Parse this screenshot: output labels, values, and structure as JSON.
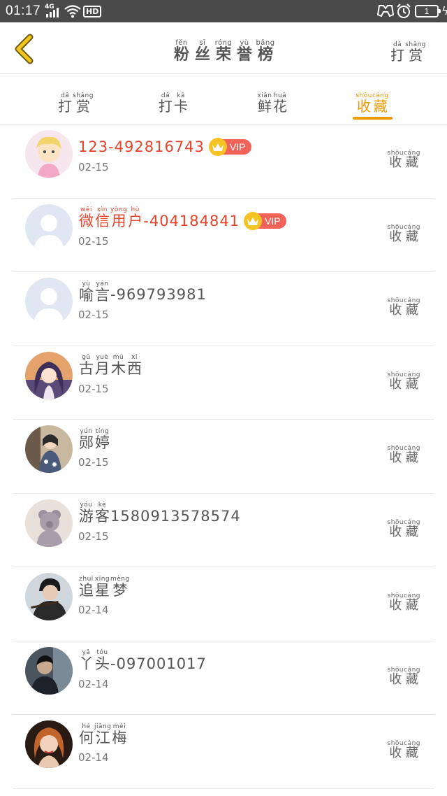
{
  "status_bar": {
    "time": "01:17",
    "network": "4G",
    "hd_label": "HD",
    "battery_level": "1",
    "icons": [
      "signal-icon",
      "wifi-icon",
      "hd-icon",
      "game-icon",
      "alarm-icon",
      "battery-icon",
      "charging-icon"
    ]
  },
  "header": {
    "back_icon": "chevron-left-icon",
    "title": [
      {
        "py": "fěn",
        "hz": "粉"
      },
      {
        "py": "sī",
        "hz": "丝"
      },
      {
        "py": "róng",
        "hz": "荣"
      },
      {
        "py": "yù",
        "hz": "誉"
      },
      {
        "py": "bǎng",
        "hz": "榜"
      }
    ],
    "action": [
      {
        "py": "dǎ",
        "hz": "打"
      },
      {
        "py": "shǎng",
        "hz": "赏"
      }
    ]
  },
  "tabs": [
    {
      "chars": [
        {
          "py": "dǎ",
          "hz": "打"
        },
        {
          "py": "shǎng",
          "hz": "赏"
        }
      ],
      "active": false
    },
    {
      "chars": [
        {
          "py": "dǎ",
          "hz": "打"
        },
        {
          "py": "kǎ",
          "hz": "卡"
        }
      ],
      "active": false
    },
    {
      "chars": [
        {
          "py": "xiān",
          "hz": "鲜"
        },
        {
          "py": "huā",
          "hz": "花"
        }
      ],
      "active": false
    },
    {
      "chars": [
        {
          "py": "shōu",
          "hz": "收"
        },
        {
          "py": "cáng",
          "hz": "藏"
        }
      ],
      "active": true
    }
  ],
  "colors": {
    "accent": "#f39800",
    "vip_name": "#e6432b",
    "vip_badge": "#f1635a",
    "crown": "#f6c325",
    "status_bar": "#4a4a4a"
  },
  "row_action": [
    {
      "py": "shōu",
      "hz": "收"
    },
    {
      "py": "cáng",
      "hz": "藏"
    }
  ],
  "users": [
    {
      "chars": [],
      "suffix": "123-492816743",
      "vip": true,
      "vip_label": "VIP",
      "date": "02-15",
      "avatar": "cartoon-girl-avatar"
    },
    {
      "chars": [
        {
          "py": "wēi",
          "hz": "微"
        },
        {
          "py": "xìn",
          "hz": "信"
        },
        {
          "py": "yòng",
          "hz": "用"
        },
        {
          "py": "hù",
          "hz": "户"
        }
      ],
      "suffix": "-404184841",
      "vip": true,
      "vip_label": "VIP",
      "date": "02-15",
      "avatar": "default-user-avatar"
    },
    {
      "chars": [
        {
          "py": "yù",
          "hz": "喻"
        },
        {
          "py": "yán",
          "hz": "言"
        }
      ],
      "suffix": "-969793981",
      "vip": false,
      "date": "02-15",
      "avatar": "default-user-avatar"
    },
    {
      "chars": [
        {
          "py": "gǔ",
          "hz": "古"
        },
        {
          "py": "yuè",
          "hz": "月"
        },
        {
          "py": "mù",
          "hz": "木"
        },
        {
          "py": "xī",
          "hz": "西"
        }
      ],
      "suffix": "",
      "vip": false,
      "date": "02-15",
      "avatar": "anime-girl-avatar"
    },
    {
      "chars": [
        {
          "py": "yún",
          "hz": "郧"
        },
        {
          "py": "tíng",
          "hz": "婷"
        }
      ],
      "suffix": "",
      "vip": false,
      "date": "02-15",
      "avatar": "photo-girl-avatar"
    },
    {
      "chars": [
        {
          "py": "yóu",
          "hz": "游"
        },
        {
          "py": "kè",
          "hz": "客"
        }
      ],
      "suffix": "15809135785​74",
      "vip": false,
      "date": "02-15",
      "avatar": "teddy-bear-avatar"
    },
    {
      "chars": [
        {
          "py": "zhuī",
          "hz": "追"
        },
        {
          "py": "xīng",
          "hz": "星"
        },
        {
          "py": "mèng",
          "hz": "梦"
        }
      ],
      "suffix": "",
      "vip": false,
      "date": "02-14",
      "avatar": "man-flute-avatar"
    },
    {
      "chars": [
        {
          "py": "yā",
          "hz": "丫"
        },
        {
          "py": "tóu",
          "hz": "头"
        }
      ],
      "suffix": "-097001017",
      "vip": false,
      "date": "02-14",
      "avatar": "dark-photo-avatar"
    },
    {
      "chars": [
        {
          "py": "hé",
          "hz": "何"
        },
        {
          "py": "jiāng",
          "hz": "江"
        },
        {
          "py": "méi",
          "hz": "梅"
        }
      ],
      "suffix": "",
      "vip": false,
      "date": "02-14",
      "avatar": "woman-portrait-avatar"
    }
  ]
}
